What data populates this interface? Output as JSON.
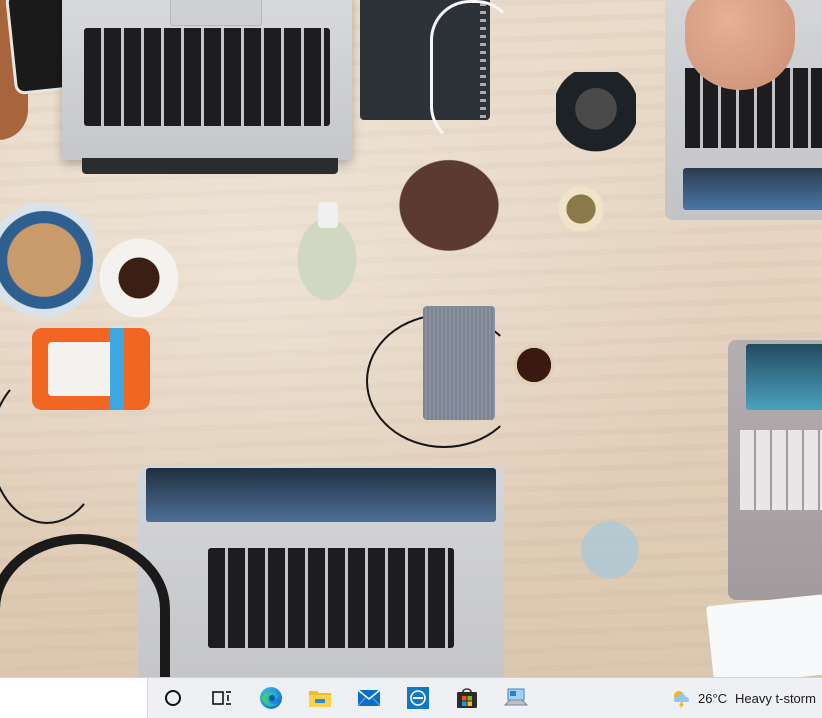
{
  "desktop": {
    "wallpaper": "desk-with-laptops-photo"
  },
  "taskbar": {
    "background": "#eef0f3",
    "search_box": {
      "placeholder": ""
    },
    "icons": [
      {
        "name": "cortana-icon"
      },
      {
        "name": "task-view-icon"
      },
      {
        "name": "edge-icon"
      },
      {
        "name": "file-explorer-icon"
      },
      {
        "name": "mail-icon"
      },
      {
        "name": "dell-icon"
      },
      {
        "name": "store-icon"
      },
      {
        "name": "connect-icon"
      }
    ],
    "weather": {
      "icon": "thunderstorm-icon",
      "temperature": "26°C",
      "condition": "Heavy t-storm"
    }
  }
}
